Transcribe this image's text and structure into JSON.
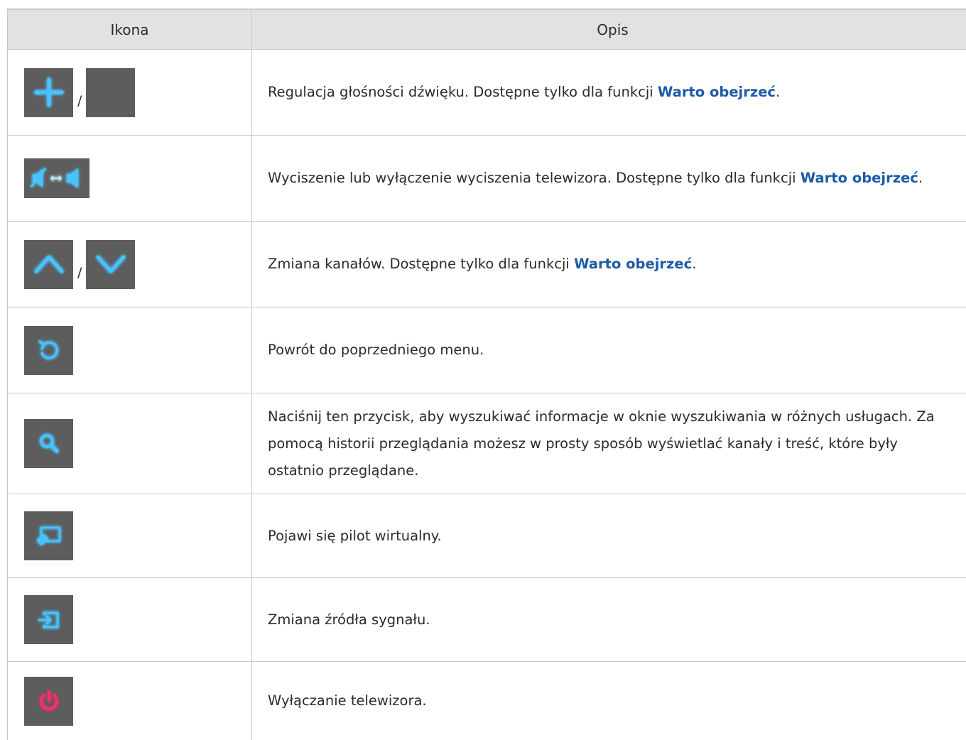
{
  "header": {
    "col_icon": "Ikona",
    "col_desc": "Opis"
  },
  "rows": [
    {
      "icon": "plus-minus-icons",
      "separator": "/",
      "text": "Regulacja głośności dźwięku. Dostępne tylko dla funkcji ",
      "highlight": "Warto obejrzeć",
      "suffix": "."
    },
    {
      "icon": "mute-toggle-icon",
      "text": "Wyciszenie lub wyłączenie wyciszenia telewizora. Dostępne tylko dla funkcji ",
      "highlight": "Warto obejrzeć",
      "suffix": "."
    },
    {
      "icon": "chevron-up-down-icons",
      "separator": "/",
      "text": "Zmiana kanałów. Dostępne tylko dla funkcji ",
      "highlight": "Warto obejrzeć",
      "suffix": "."
    },
    {
      "icon": "return-icon",
      "text": "Powrót do poprzedniego menu."
    },
    {
      "icon": "search-icon",
      "text": "Naciśnij ten przycisk, aby wyszukiwać informacje w oknie wyszukiwania w różnych usługach. Za pomocą historii przeglądania możesz w prosty sposób wyświetlać kanały i treść, które były ostatnio przeglądane."
    },
    {
      "icon": "virtual-remote-icon",
      "text": "Pojawi się pilot wirtualny."
    },
    {
      "icon": "source-icon",
      "text": "Zmiana źródła sygnału."
    },
    {
      "icon": "power-icon",
      "text": "Wyłączanie telewizora."
    }
  ],
  "colors": {
    "button_bg": "#5d5d5d",
    "icon_blue": "#3db8ff",
    "icon_red": "#ff2d6a",
    "highlight": "#1d5ba7",
    "header_bg": "#e2e2e2"
  }
}
